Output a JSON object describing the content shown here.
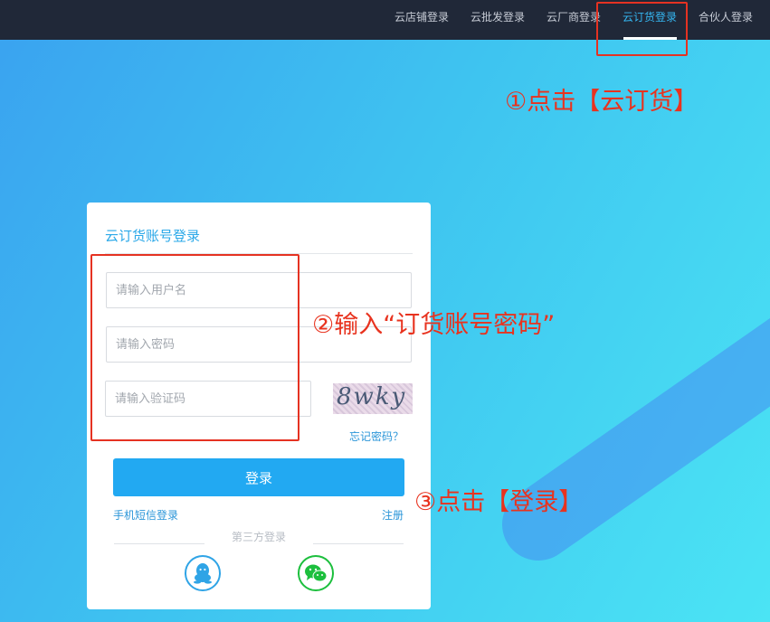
{
  "nav": {
    "items": [
      {
        "label": "云店铺登录"
      },
      {
        "label": "云批发登录"
      },
      {
        "label": "云厂商登录"
      },
      {
        "label": "云订货登录",
        "active": true
      },
      {
        "label": "合伙人登录"
      }
    ]
  },
  "card": {
    "title": "云订货账号登录",
    "username_placeholder": "请输入用户名",
    "password_placeholder": "请输入密码",
    "captcha_placeholder": "请输入验证码",
    "captcha_text": "8wky",
    "forgot_label": "忘记密码？",
    "login_label": "登录",
    "sms_login_label": "手机短信登录",
    "register_label": "注册",
    "third_party_label": "第三方登录"
  },
  "annotations": {
    "step1": "①点击【云订货】",
    "step2": "②输入“订货账号密码”",
    "step3": "③点击【登录】"
  },
  "colors": {
    "topbar": "#202838",
    "accent": "#22a9f2",
    "annotation": "#e8331f",
    "qq": "#2fa4e6",
    "wechat": "#1cbf3d"
  },
  "icons": {
    "qq": "qq-icon",
    "wechat": "wechat-icon"
  }
}
